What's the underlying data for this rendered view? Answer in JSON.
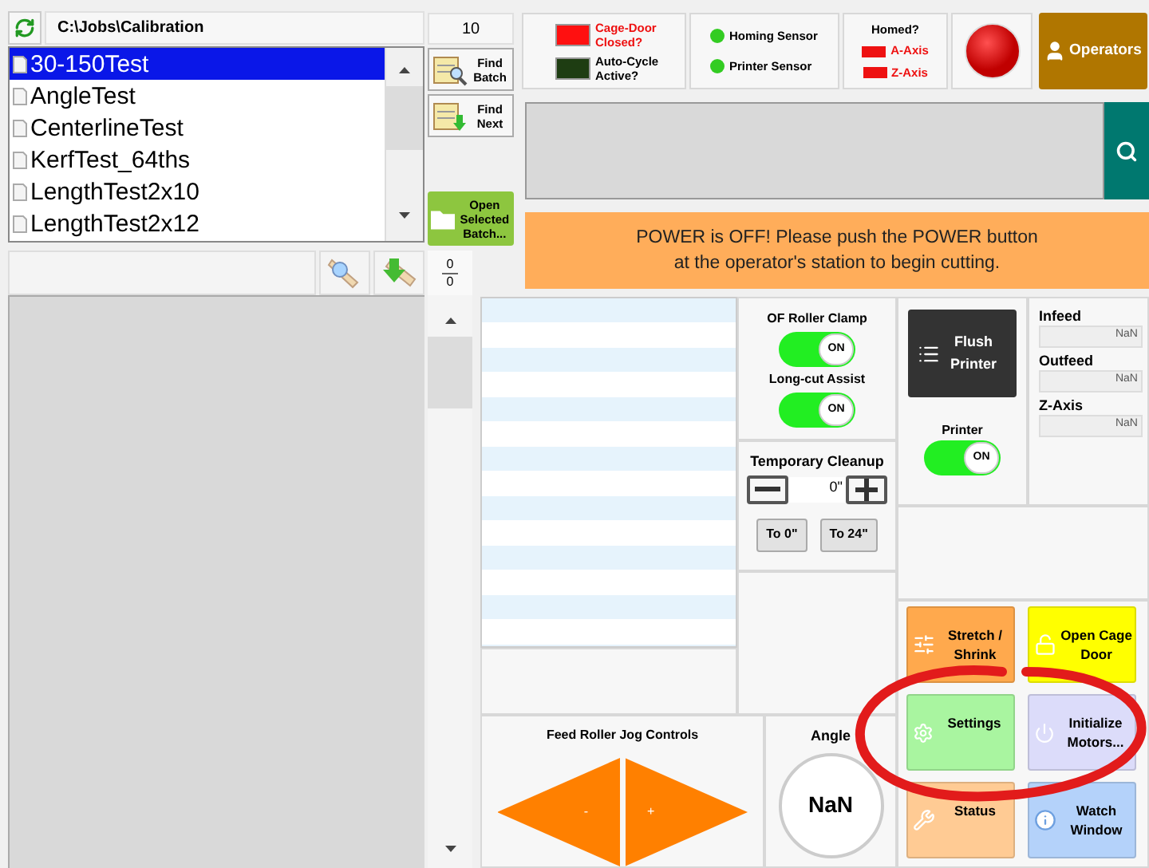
{
  "batch_browser": {
    "path": "C:\\Jobs\\Calibration",
    "count": "10",
    "batches": [
      {
        "name": "30-150Test",
        "selected": true
      },
      {
        "name": "AngleTest",
        "selected": false
      },
      {
        "name": "CenterlineTest",
        "selected": false
      },
      {
        "name": "KerfTest_64ths",
        "selected": false
      },
      {
        "name": "LengthTest2x10",
        "selected": false
      },
      {
        "name": "LengthTest2x12",
        "selected": false
      }
    ],
    "buttons": [
      {
        "kind": "find",
        "label": "Find Batch"
      },
      {
        "kind": "next",
        "label": "Find Next"
      }
    ],
    "open_button": "Open Selected Batch..."
  },
  "pieces": {
    "current": "0",
    "total": "0"
  },
  "indicators": [
    {
      "label": "Cage-Door Closed?",
      "color": "#ff1010",
      "alert": true
    },
    {
      "label": "Auto-Cycle Active?",
      "color": "#1e3d12",
      "alert": false
    }
  ],
  "sensors": [
    {
      "label": "Homing Sensor",
      "color": "#33cc22"
    },
    {
      "label": "Printer Sensor",
      "color": "#33cc22"
    }
  ],
  "homed": {
    "title": "Homed?",
    "axes": [
      {
        "label": "A-Axis",
        "homed": false
      },
      {
        "label": "Z-Axis",
        "homed": false
      }
    ]
  },
  "operators_button": "Operators",
  "message": [
    "POWER is OFF! Please push the POWER button",
    "at the operator's station to begin cutting."
  ],
  "toggles": [
    {
      "label": "OF Roller Clamp",
      "on": true,
      "text": "ON"
    },
    {
      "label": "Long-cut Assist",
      "on": true,
      "text": "ON"
    }
  ],
  "cleanup": {
    "title": "Temporary Cleanup",
    "value": "0\"",
    "buttons": [
      "To 0\"",
      "To 24\""
    ]
  },
  "flush_button": "Flush Printer",
  "printer_toggle": {
    "label": "Printer",
    "on": true,
    "text": "ON"
  },
  "positions": [
    {
      "label": "Infeed",
      "value": "NaN"
    },
    {
      "label": "Outfeed",
      "value": "NaN"
    },
    {
      "label": "Z-Axis",
      "value": "NaN"
    }
  ],
  "actions": [
    {
      "kind": "sliders",
      "label": "Stretch / Shrink",
      "color": "#ffa94d"
    },
    {
      "kind": "unlock",
      "label": "Open Cage Door",
      "color": "#ffff00"
    },
    {
      "kind": "gear",
      "label": "Settings",
      "color": "#a9f5a0"
    },
    {
      "kind": "power",
      "label": "Initialize Motors...",
      "color": "#dcdcfa"
    },
    {
      "kind": "tools",
      "label": "Status",
      "color": "#ffcb94"
    },
    {
      "kind": "info",
      "label": "Watch Window",
      "color": "#b4d2fa"
    }
  ],
  "jog": {
    "title": "Feed Roller Jog Controls",
    "minus": "-",
    "plus": "+"
  },
  "angle": {
    "title": "Angle",
    "value": "NaN"
  }
}
